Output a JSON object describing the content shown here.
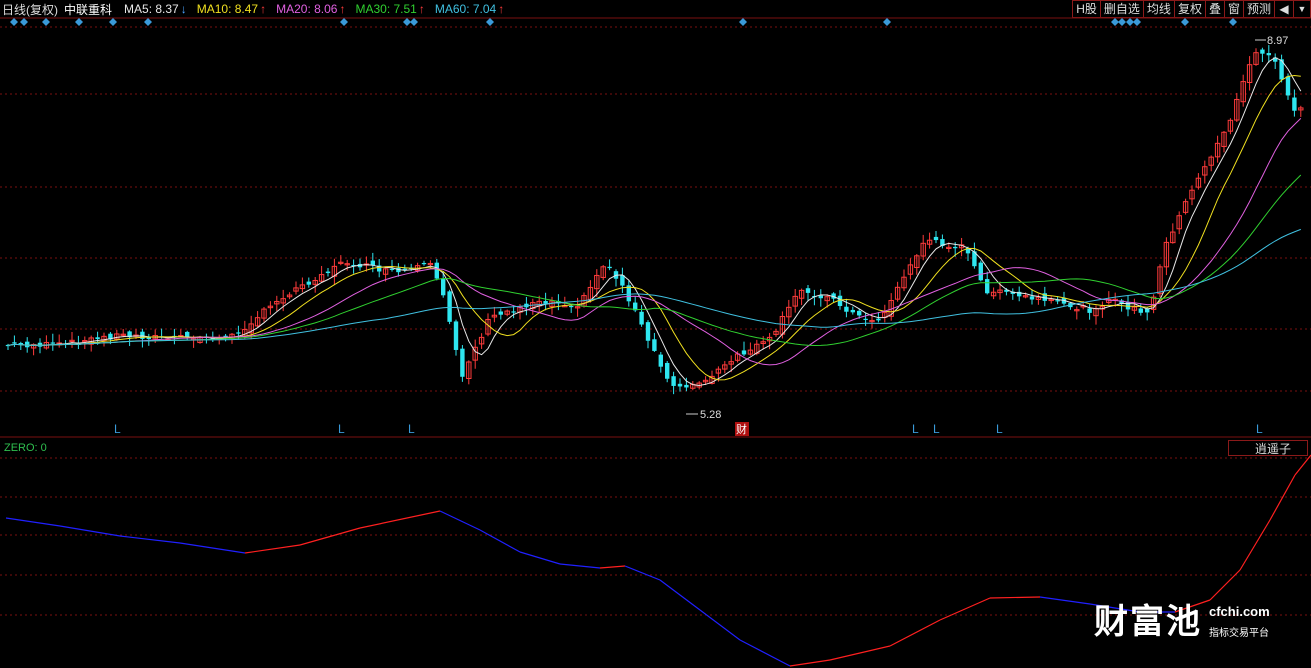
{
  "header": {
    "period_label": "日线(复权)",
    "stock_name": "中联重科",
    "ma": [
      {
        "label": "MA5: 8.37",
        "arrow": "↓",
        "color": "#e8e8e8",
        "arrow_dir": "down"
      },
      {
        "label": "MA10: 8.47",
        "arrow": "↑",
        "color": "#f0e020",
        "arrow_dir": "up"
      },
      {
        "label": "MA20: 8.06",
        "arrow": "↑",
        "color": "#e060e0",
        "arrow_dir": "up"
      },
      {
        "label": "MA30: 7.51",
        "arrow": "↑",
        "color": "#30d030",
        "arrow_dir": "up"
      },
      {
        "label": "MA60: 7.04",
        "arrow": "↑",
        "color": "#40c0e0",
        "arrow_dir": "up"
      }
    ]
  },
  "toolbar": {
    "buttons": [
      "H股",
      "删自选",
      "均线",
      "复权",
      "叠",
      "窗",
      "预测"
    ],
    "sound_icon": "speaker-icon",
    "dropdown_icon": "triangle-down-icon"
  },
  "price_chart": {
    "high_label": "8.97",
    "low_label": "5.28",
    "event_label": "财",
    "signal_marker": "L"
  },
  "indicator": {
    "zero_label": "ZERO: 0",
    "selected": "逍遥子"
  },
  "watermark": {
    "brand": "财富池",
    "site": "cfchi.com",
    "subtitle": "指标交易平台"
  },
  "colors": {
    "up_candle": "#ff3b3b",
    "down_candle": "#2ee6f0",
    "grid": "#7a1010",
    "indicator_up": "#ff2020",
    "indicator_down": "#2020ff",
    "diamond": "#3a9ad9",
    "signal": "#3a9ad9"
  }
}
